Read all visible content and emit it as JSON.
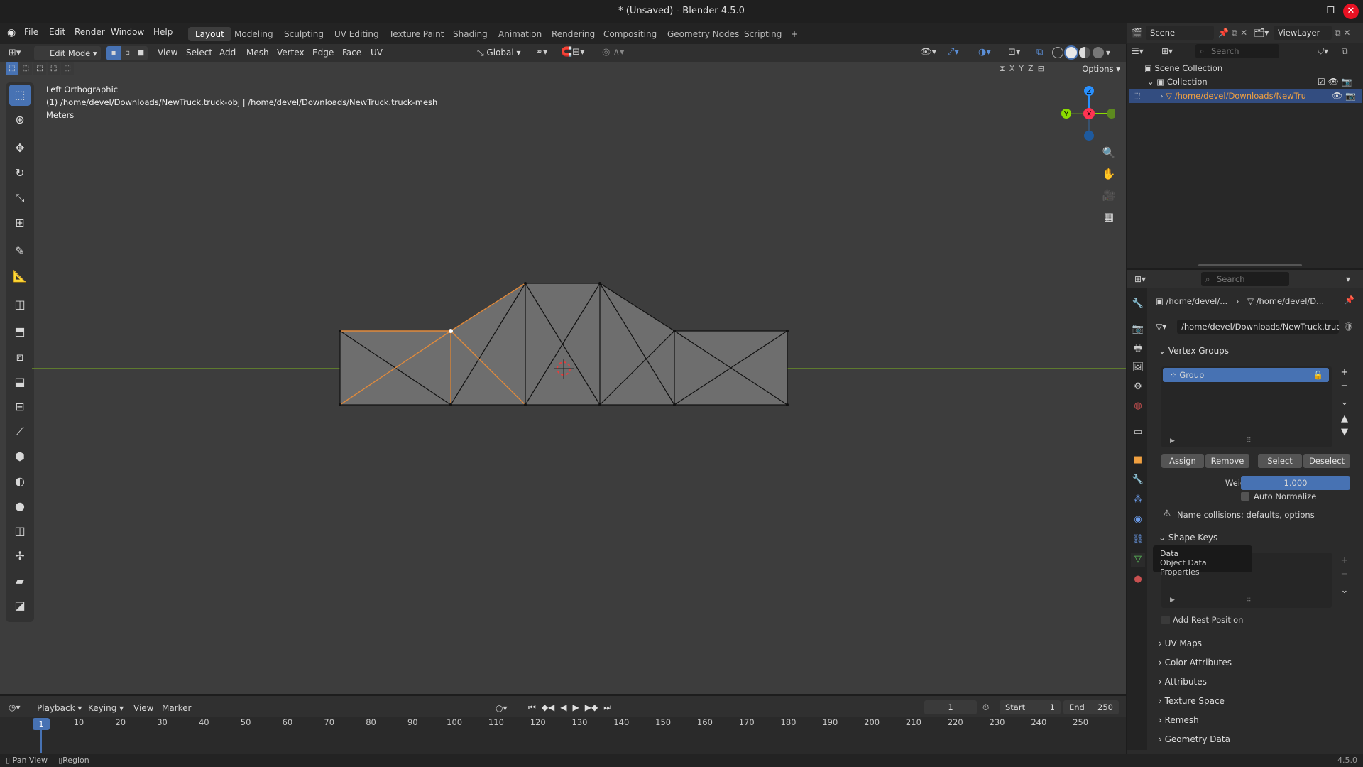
{
  "window": {
    "title": "* (Unsaved) - Blender 4.5.0",
    "controls": {
      "minimize": "–",
      "maximize": "❐",
      "close": "✕"
    }
  },
  "menubar": {
    "items": [
      "File",
      "Edit",
      "Render",
      "Window",
      "Help"
    ],
    "workspaces": [
      "Layout",
      "Modeling",
      "Sculpting",
      "UV Editing",
      "Texture Paint",
      "Shading",
      "Animation",
      "Rendering",
      "Compositing",
      "Geometry Nodes",
      "Scripting"
    ],
    "active_workspace": "Layout",
    "add_workspace": "+"
  },
  "viewport_header": {
    "mode": "Edit Mode",
    "menus": [
      "View",
      "Select",
      "Add",
      "Mesh",
      "Vertex",
      "Edge",
      "Face",
      "UV"
    ],
    "orientation": "Global",
    "options_label": "Options",
    "axis_toggles": [
      "X",
      "Y",
      "Z"
    ]
  },
  "viewport_overlay": {
    "view_name": "Left Orthographic",
    "object_path": "(1) /home/devel/Downloads/NewTruck.truck-obj | /home/devel/Downloads/NewTruck.truck-mesh",
    "units": "Meters"
  },
  "gizmo": {
    "z": "Z",
    "y": "Y",
    "x": "X"
  },
  "colors": {
    "accent": "#4772b3",
    "selected_edge": "#e08a3c",
    "axis_y_line": "#6a8f2a",
    "axis_x": "#ff3352",
    "axis_y": "#8bdc00",
    "axis_z": "#2890ff"
  },
  "outliner": {
    "scene_label": "Scene",
    "viewlayer_label": "ViewLayer",
    "search_placeholder": "Search",
    "scene_collection": "Scene Collection",
    "collection": "Collection",
    "object_name": "/home/devel/Downloads/NewTru"
  },
  "properties": {
    "search_placeholder": "Search",
    "breadcrumb_1": "/home/devel/...",
    "breadcrumb_2": "/home/devel/D...",
    "mesh_name": "/home/devel/Downloads/NewTruck.truc...",
    "vertex_groups": {
      "title": "Vertex Groups",
      "items": [
        "Group"
      ],
      "buttons": [
        "Assign",
        "Remove",
        "Select",
        "Deselect"
      ],
      "weight_label": "Weight",
      "weight_value": "1.000",
      "auto_normalize": "Auto Normalize",
      "warning": "Name collisions: defaults, options"
    },
    "shape_keys": {
      "title": "Shape Keys",
      "add_rest": "Add Rest Position"
    },
    "tooltip": {
      "title": "Data",
      "subtitle": "Object Data Properties"
    },
    "collapsed_panels": [
      "UV Maps",
      "Color Attributes",
      "Attributes",
      "Texture Space",
      "Remesh",
      "Geometry Data"
    ]
  },
  "timeline": {
    "menus": [
      "Playback",
      "Keying",
      "View",
      "Marker"
    ],
    "current_frame": "1",
    "start_label": "Start",
    "start_value": "1",
    "end_label": "End",
    "end_value": "250",
    "ruler": [
      "1",
      "10",
      "20",
      "30",
      "40",
      "50",
      "60",
      "70",
      "80",
      "90",
      "100",
      "110",
      "120",
      "130",
      "140",
      "150",
      "160",
      "170",
      "180",
      "190",
      "200",
      "210",
      "220",
      "230",
      "240",
      "250"
    ]
  },
  "statusbar": {
    "left_1": "Pan View",
    "left_2": "Region",
    "version": "4.5.0"
  }
}
